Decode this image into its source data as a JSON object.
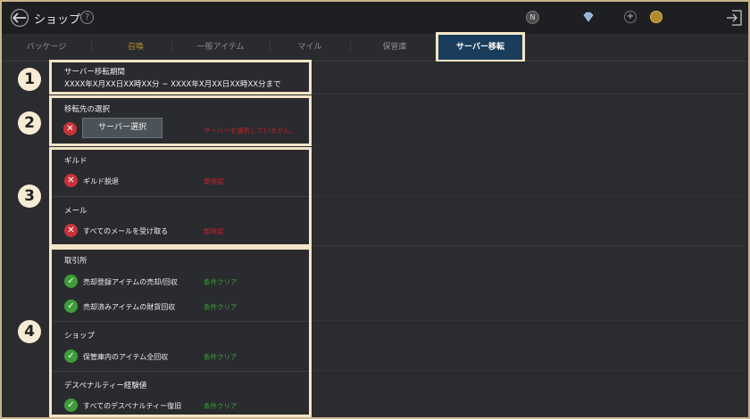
{
  "header": {
    "title": "ショップ",
    "help": "?",
    "currency_n": "N",
    "plus": "+"
  },
  "tabs": [
    {
      "label": "パッケージ"
    },
    {
      "label": "召喚"
    },
    {
      "label": "一般アイテム"
    },
    {
      "label": "マイル"
    },
    {
      "label": "保管庫"
    },
    {
      "label": "サーバー移転"
    }
  ],
  "steps": [
    "1",
    "2",
    "3",
    "4"
  ],
  "period": {
    "label": "サーバー移転期間",
    "value": "XXXX年X月XX日XX時XX分 ~ XXXX年X月XX日XX時XX分まで"
  },
  "destination": {
    "label": "移転先の選択",
    "button": "サーバー選択",
    "status": "サーバーを選択していません。"
  },
  "guild": {
    "label": "ギルド",
    "item": "ギルド脱退",
    "status": "要確認"
  },
  "mail": {
    "label": "メール",
    "item": "すべてのメールを受け取る",
    "status": "要確認"
  },
  "exchange": {
    "label": "取引所",
    "items": [
      {
        "text": "売却登録アイテムの売却/回収",
        "status": "条件クリア"
      },
      {
        "text": "売却済みアイテムの財貨回収",
        "status": "条件クリア"
      }
    ]
  },
  "shop": {
    "label": "ショップ",
    "item": "保管庫内のアイテム全回収",
    "status": "条件クリア"
  },
  "death_penalty": {
    "label": "デスペナルティー経験値",
    "item": "すべてのデスペナルティー復旧",
    "status": "条件クリア"
  }
}
